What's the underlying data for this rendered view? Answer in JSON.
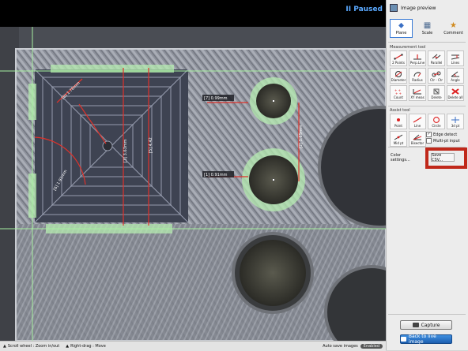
{
  "viewer": {
    "status": "II Paused",
    "measurements": [
      {
        "id": "diag-left",
        "text": "[8] 1.76mm"
      },
      {
        "id": "vertical-center",
        "text": "[3] 3.63mm"
      },
      {
        "id": "vertical-right",
        "text": "[5] 4.42"
      },
      {
        "id": "arc-left",
        "text": "[6] 1.91mm"
      },
      {
        "id": "circle-top",
        "text": "[7] 0.99mm"
      },
      {
        "id": "circle-bottom",
        "text": "[1] 0.91mm"
      },
      {
        "id": "vertical-circles",
        "text": "[2] 1.69mm"
      }
    ]
  },
  "statusbar": {
    "scroll_hint": "Scroll wheel : Zoom in/out",
    "drag_hint": "Right-drag : Move",
    "auto_save_label": "Auto save images",
    "auto_save_state": "Enabled"
  },
  "panel": {
    "title": "Image preview",
    "modes": [
      {
        "label": "Plane",
        "icon": "plane-icon",
        "selected": true
      },
      {
        "label": "Scale",
        "icon": "scale-icon",
        "selected": false
      },
      {
        "label": "Comment",
        "icon": "comment-icon",
        "selected": false
      }
    ],
    "measurement_tool_label": "Measurement tool",
    "measurement_tools": [
      {
        "label": "2 Points",
        "icon": "two-points-icon"
      },
      {
        "label": "Perp.Line",
        "icon": "perpendicular-line-icon"
      },
      {
        "label": "Parallel",
        "icon": "parallel-icon"
      },
      {
        "label": "Lines",
        "icon": "lines-icon"
      },
      {
        "label": "Diameter",
        "icon": "diameter-icon"
      },
      {
        "label": "Radius",
        "icon": "radius-icon"
      },
      {
        "label": "Ctr - Ctr",
        "icon": "center-to-center-icon"
      },
      {
        "label": "Angle",
        "icon": "angle-icon"
      },
      {
        "label": "Count",
        "icon": "count-icon"
      },
      {
        "label": "XY meas",
        "icon": "xy-measure-icon"
      },
      {
        "label": "Delete",
        "icon": "delete-icon"
      },
      {
        "label": "Delete all",
        "icon": "delete-all-icon"
      }
    ],
    "assist_tool_label": "Assist tool",
    "assist_tools": [
      {
        "label": "Point",
        "icon": "point-icon"
      },
      {
        "label": "Line",
        "icon": "line-icon"
      },
      {
        "label": "Circle",
        "icon": "circle-icon"
      },
      {
        "label": "3d pt",
        "icon": "three-d-point-icon"
      },
      {
        "label": "Mid pt",
        "icon": "mid-point-icon"
      },
      {
        "label": "Bisector",
        "icon": "bisector-icon"
      }
    ],
    "edge_detect_label": "Edge detect",
    "edge_detect_checked": true,
    "multi_pt_label": "Multi-pt input",
    "multi_pt_checked": false,
    "color_settings_label": "Color settings...",
    "save_csv_label": "Save CSV...",
    "capture_label": "Capture",
    "back_label": "Back to live image"
  }
}
